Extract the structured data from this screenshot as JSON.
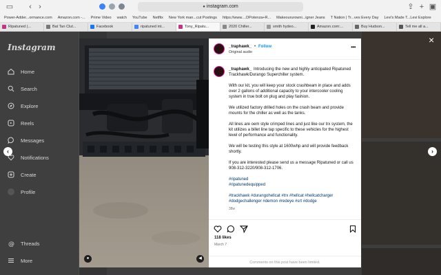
{
  "browser": {
    "url": "instagram.com",
    "bookmarks": [
      "Power-Adder...ormance.com",
      "Amazon.com -...",
      "Prime Video",
      "watch",
      "YouTube",
      "Netflix",
      "New York man...cut Postings",
      "https://www....DPotenza+R...",
      "Makeoururowni...igner Jeans",
      "T Nation | Tr...ves Every Day",
      "Levi's Made T...Levi Explore"
    ],
    "tabs": [
      "Ripatuned (...",
      "Bat Tan Clut...",
      "Facebook",
      "ripatuned int...",
      "Tony_Ripatu...",
      "2020 Chiller...",
      "smith hydeo...",
      "Amazon.com:...",
      "Buy Hudson...",
      "Tell me all a..."
    ],
    "active_tab_index": 4
  },
  "sidebar": {
    "logo": "Instagram",
    "items": [
      {
        "label": "Home",
        "icon": "home-icon"
      },
      {
        "label": "Search",
        "icon": "search-icon"
      },
      {
        "label": "Explore",
        "icon": "compass-icon"
      },
      {
        "label": "Reels",
        "icon": "reels-icon"
      },
      {
        "label": "Messages",
        "icon": "messenger-icon"
      },
      {
        "label": "Notifications",
        "icon": "heart-icon"
      },
      {
        "label": "Create",
        "icon": "plus-square-icon"
      },
      {
        "label": "Profile",
        "icon": "profile-icon"
      }
    ],
    "bottom": [
      {
        "label": "Threads",
        "icon": "threads-icon"
      },
      {
        "label": "More",
        "icon": "menu-icon"
      }
    ]
  },
  "post": {
    "username": "_traphawk_",
    "separator": "•",
    "follow_label": "Follow",
    "audio": "Original audio",
    "caption_intro": "Introducing the new and highly anticipated Ripatuned Trackhawk/Durango Superchiller system.",
    "paragraphs": [
      "With our kit, you will keep your stock crashbeam in place and adds over 2 gallons of additional capacity to your intercooler cooling system in true bolt on plug and play fashion.",
      "We utilized factory drilled holes on the crash beam and provide mounts for the chiller as well as the tanks.",
      "All lines are oem style crimped lines and just like our trx system, the kit utilizes a billet line tap specific to these vehicles for the highest level of performance and functionality.",
      "We will be testing this style at 1600whp and will provide feedback shortly.",
      "If you are interested please send us a message Ripatuned or call us 908-312-3220/908-312-1706."
    ],
    "hashtags_1": "#ripatuned",
    "hashtags_2": "#ripatunedequipped",
    "hashtags_3": "#trackhawk #durangohellcat #trx #hellcat #hellcatcharger #dodgechallenger #demon #redeye #srt #dodge",
    "ago": "38w",
    "likes": "118 likes",
    "date": "March 7",
    "comments_limited": "Comments on this post have been limited."
  }
}
